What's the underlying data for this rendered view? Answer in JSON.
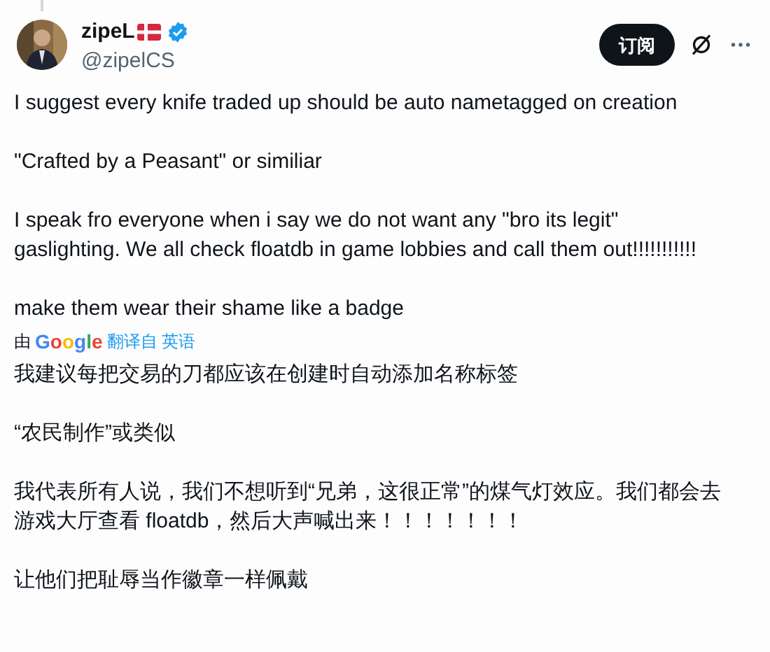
{
  "author": {
    "name": "zipeL",
    "handle": "@zipelCS",
    "verified": true
  },
  "subscribe_button": "订阅",
  "paragraphs": [
    "I suggest every knife traded up should be auto nametagged on creation",
    "\"Crafted by a Peasant\" or similiar",
    "I speak fro everyone when i say we do not want any \"bro its legit\" gaslighting. We all check floatdb in game lobbies and call them out!!!!!!!!!!!",
    "make them wear their shame like a badge"
  ],
  "translation": {
    "by": "由",
    "brand": "Google",
    "label": "翻译自 英语",
    "paragraphs": [
      "我建议每把交易的刀都应该在创建时自动添加名称标签",
      "“农民制作”或类似",
      "我代表所有人说，我们不想听到“兄弟，这很正常”的煤气灯效应。我们都会去游戏大厅查看 floatdb，然后大声喊出来！！！！！！！",
      "让他们把耻辱当作徽章一样佩戴"
    ]
  }
}
